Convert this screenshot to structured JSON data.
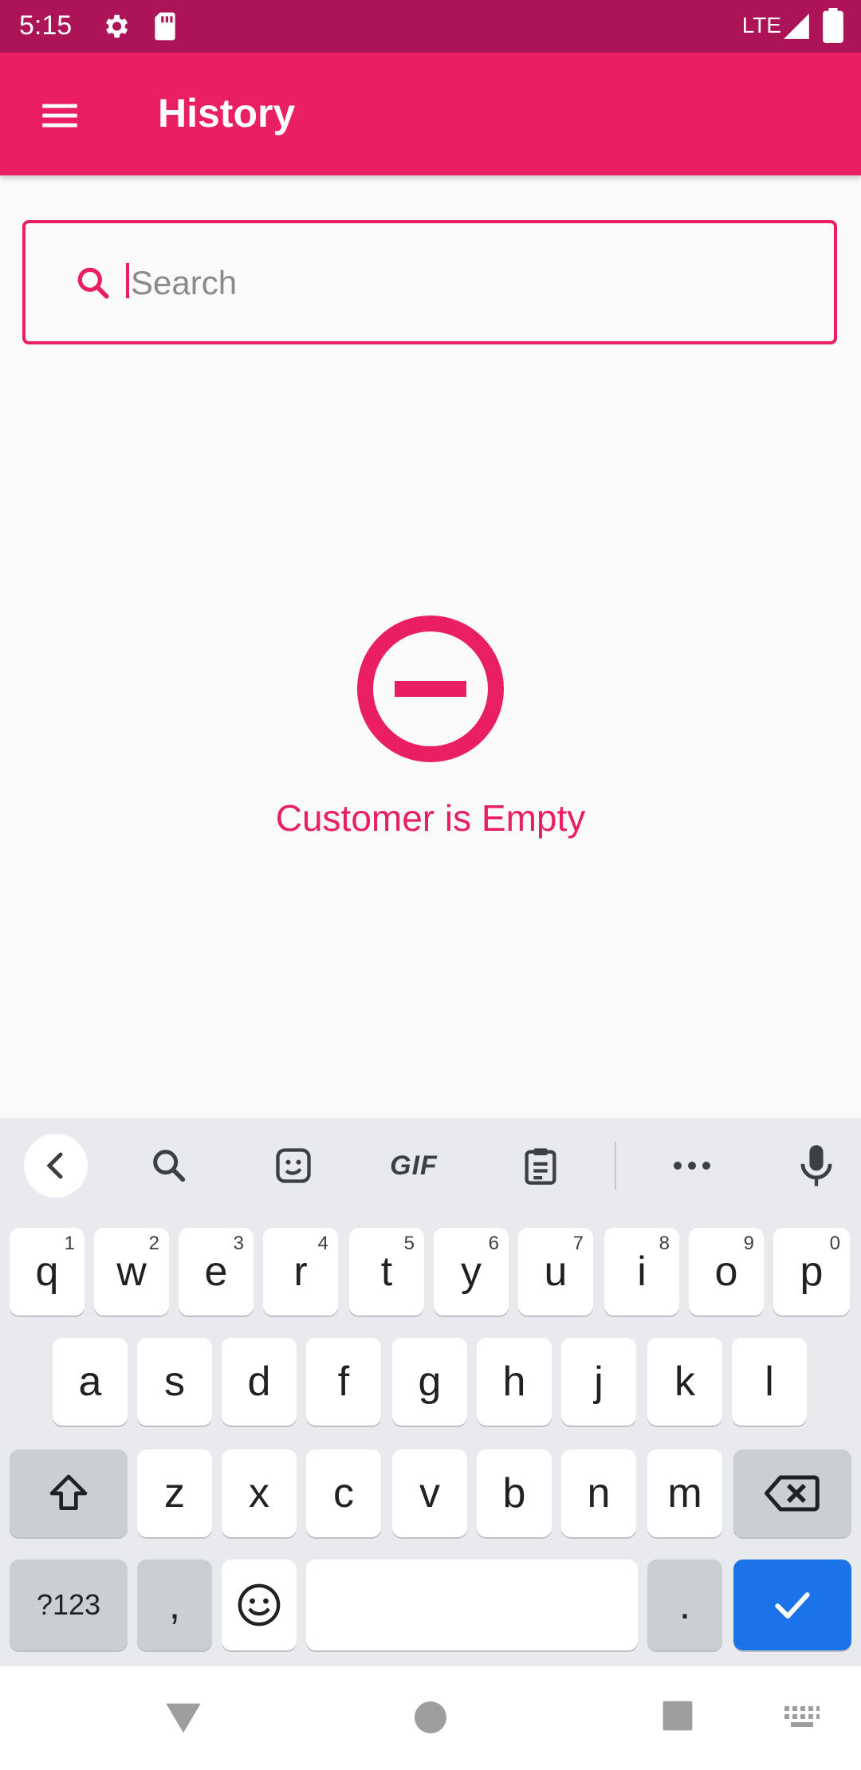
{
  "status_bar": {
    "time": "5:15",
    "network": "LTE"
  },
  "app_bar": {
    "title": "History"
  },
  "search": {
    "placeholder": "Search"
  },
  "empty_state": {
    "message": "Customer is Empty"
  },
  "keyboard": {
    "toolbar": {
      "gif_label": "GIF"
    },
    "row1": [
      {
        "label": "q",
        "hint": "1"
      },
      {
        "label": "w",
        "hint": "2"
      },
      {
        "label": "e",
        "hint": "3"
      },
      {
        "label": "r",
        "hint": "4"
      },
      {
        "label": "t",
        "hint": "5"
      },
      {
        "label": "y",
        "hint": "6"
      },
      {
        "label": "u",
        "hint": "7"
      },
      {
        "label": "i",
        "hint": "8"
      },
      {
        "label": "o",
        "hint": "9"
      },
      {
        "label": "p",
        "hint": "0"
      }
    ],
    "row2": [
      "a",
      "s",
      "d",
      "f",
      "g",
      "h",
      "j",
      "k",
      "l"
    ],
    "row3": [
      "z",
      "x",
      "c",
      "v",
      "b",
      "n",
      "m"
    ],
    "row4": {
      "symbols": "?123",
      "comma": ",",
      "period": "."
    }
  },
  "colors": {
    "accent": "#e91e63",
    "status_bar": "#ad1457",
    "enter_key": "#1a73e8"
  }
}
